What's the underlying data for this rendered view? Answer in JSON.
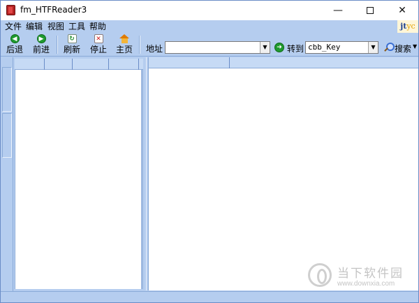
{
  "window": {
    "title": "fm_HTFReader3",
    "minimize_glyph": "—",
    "close_glyph": "✕"
  },
  "menu": {
    "items": [
      "文件",
      "编辑",
      "视图",
      "工具",
      "帮助"
    ]
  },
  "brand_logo": {
    "text_a": "jt",
    "text_b": "yc"
  },
  "toolbar": {
    "back_label": "后退",
    "forward_label": "前进",
    "refresh_label": "刷新",
    "stop_label": "停止",
    "home_label": "主页",
    "address_label": "地址",
    "address_value": "",
    "go_label": "转到",
    "key_combo_value": "cbb_Key",
    "search_label": "搜索",
    "icons": {
      "back": "back-arrow-icon",
      "forward": "forward-arrow-icon",
      "refresh": "refresh-icon",
      "stop": "stop-icon",
      "home": "home-icon",
      "go": "go-icon",
      "search": "search-icon"
    }
  },
  "watermark": {
    "name": "当下软件园",
    "url": "www.downxia.com"
  },
  "colors": {
    "chrome": "#b5cdef",
    "header": "#c6daf5",
    "accent_green": "#1f9a2f"
  }
}
